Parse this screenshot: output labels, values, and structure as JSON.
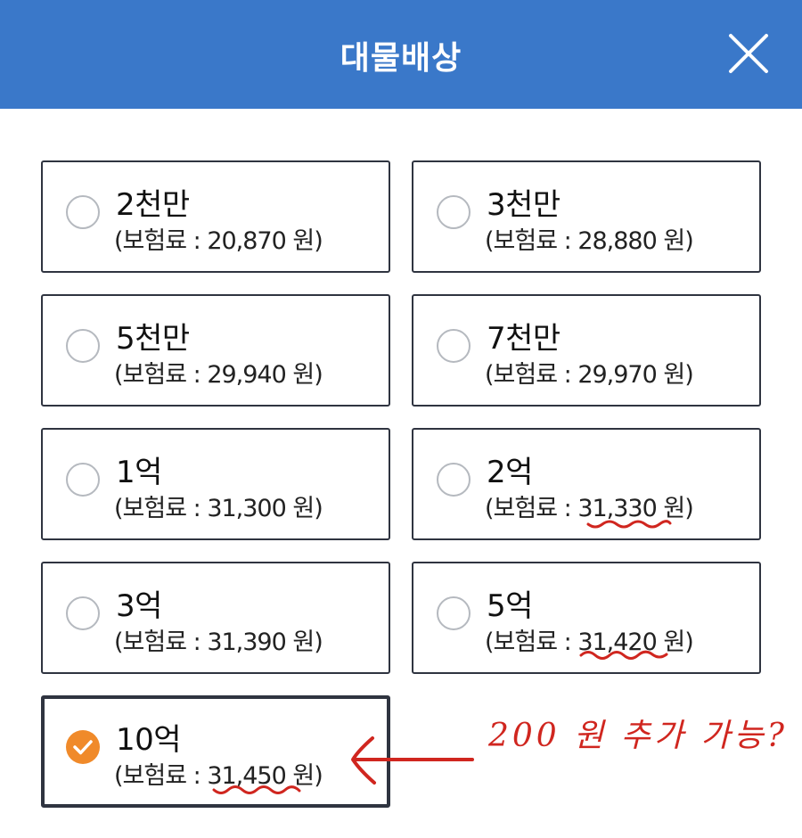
{
  "header": {
    "title": "대물배상",
    "close_icon": "close-icon",
    "background": "#3a78c9"
  },
  "options": [
    {
      "amount": "2천만",
      "premium": "(보험료 : 20,870 원)",
      "selected": false
    },
    {
      "amount": "3천만",
      "premium": "(보험료 : 28,880 원)",
      "selected": false
    },
    {
      "amount": "5천만",
      "premium": "(보험료 : 29,940 원)",
      "selected": false
    },
    {
      "amount": "7천만",
      "premium": "(보험료 : 29,970 원)",
      "selected": false
    },
    {
      "amount": "1억",
      "premium": "(보험료 : 31,300 원)",
      "selected": false
    },
    {
      "amount": "2억",
      "premium": "(보험료 : 31,330 원)",
      "selected": false
    },
    {
      "amount": "3억",
      "premium": "(보험료 : 31,390 원)",
      "selected": false
    },
    {
      "amount": "5억",
      "premium": "(보험료 : 31,420 원)",
      "selected": false
    },
    {
      "amount": "10억",
      "premium": "(보험료 : 31,450 원)",
      "selected": true
    }
  ],
  "annotation": {
    "text": "200 원  추가 가능?",
    "color": "#d0261f"
  },
  "colors": {
    "selected_radio": "#f08a2a",
    "border": "#2f3440"
  }
}
